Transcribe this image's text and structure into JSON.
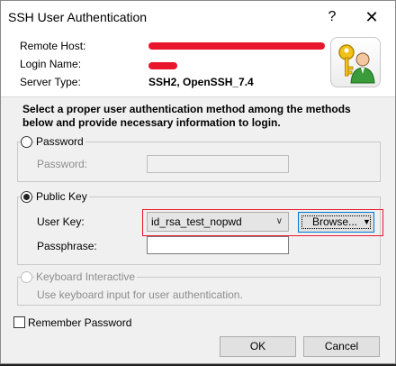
{
  "window": {
    "title": "SSH User Authentication",
    "help_glyph": "?",
    "close_glyph": "✕"
  },
  "info": {
    "remote_host_label": "Remote Host:",
    "login_name_label": "Login Name:",
    "server_type_label": "Server Type:",
    "server_type_value": "SSH2, OpenSSH_7.4"
  },
  "description": "Select a proper user authentication method among the methods below and provide necessary information to login.",
  "password_method": {
    "radio_label": "Password",
    "password_label": "Password:"
  },
  "public_key_method": {
    "radio_label": "Public Key",
    "user_key_label": "User Key:",
    "user_key_value": "id_rsa_test_nopwd",
    "browse_label": "Browse...",
    "passphrase_label": "Passphrase:"
  },
  "keyboard_method": {
    "radio_label": "Keyboard Interactive",
    "hint": "Use keyboard input for user authentication."
  },
  "remember_password_label": "Remember Password",
  "buttons": {
    "ok": "OK",
    "cancel": "Cancel"
  },
  "icons": {
    "logo": "user-key-icon",
    "dropdown": "chevron-down-icon"
  },
  "colors": {
    "redaction": "#e9162b",
    "highlight": "#e9162b",
    "focus": "#0078d7"
  }
}
